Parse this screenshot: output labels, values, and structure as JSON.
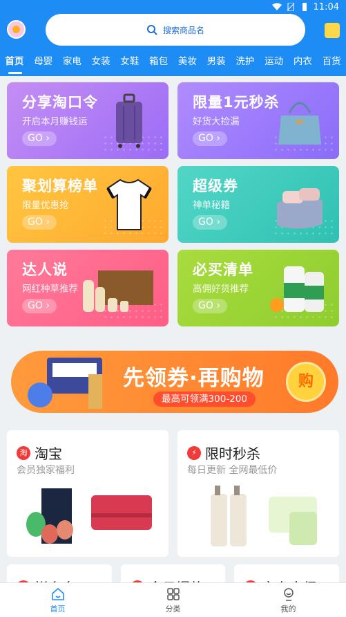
{
  "status": {
    "time": "11:04"
  },
  "header": {
    "search_placeholder": "搜索商品名"
  },
  "categories": [
    "首页",
    "母婴",
    "家电",
    "女装",
    "女鞋",
    "箱包",
    "美妆",
    "男装",
    "洗护",
    "运动",
    "内衣",
    "百货"
  ],
  "cards": [
    {
      "title": "分享淘口令",
      "subtitle": "开启本月赚钱运",
      "go": "GO"
    },
    {
      "title": "限量1元秒杀",
      "subtitle": "好货大捡漏",
      "go": "GO"
    },
    {
      "title": "聚划算榜单",
      "subtitle": "限量优惠抢",
      "go": "GO"
    },
    {
      "title": "超级券",
      "subtitle": "神单秘籍",
      "go": "GO"
    },
    {
      "title": "达人说",
      "subtitle": "网红种草推荐",
      "go": "GO"
    },
    {
      "title": "必买清单",
      "subtitle": "高佣好货推荐",
      "go": "GO"
    }
  ],
  "banner": {
    "title": "先领券·再购物",
    "subtitle": "最高可领满300-200",
    "button": "购"
  },
  "promos": [
    {
      "title": "淘宝",
      "subtitle": "会员独家福利"
    },
    {
      "title": "限时秒杀",
      "subtitle": "每日更新 全网最低价"
    },
    {
      "title": "拼多多"
    },
    {
      "title": "今日爆款"
    },
    {
      "title": "京东大促"
    }
  ],
  "tabbar": [
    {
      "label": "首页"
    },
    {
      "label": "分类"
    },
    {
      "label": "我的"
    }
  ],
  "colors": {
    "brand": "#1e8cf5",
    "accent": "#ff7a2a",
    "danger": "#f23a3a"
  }
}
